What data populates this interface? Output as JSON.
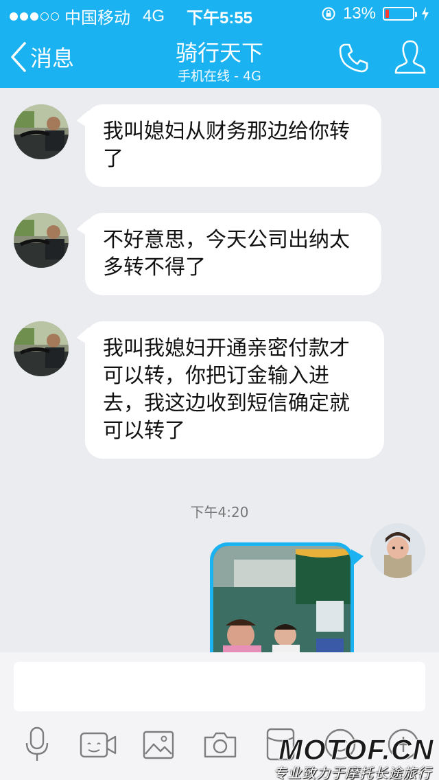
{
  "status_bar": {
    "carrier": "中国移动",
    "network": "4G",
    "time": "下午5:55",
    "battery_percent": "13%",
    "battery_level": 0.13,
    "signal_bars": 3
  },
  "nav": {
    "back_label": "消息",
    "title": "骑行天下",
    "subtitle": "手机在线 - 4G",
    "icons": [
      "back-chevron-icon",
      "phone-icon",
      "person-icon"
    ]
  },
  "messages": [
    {
      "sender": "contact",
      "text": "我叫媳妇从财务那边给你转了"
    },
    {
      "sender": "contact",
      "text": "不好意思，今天公司出纳太多转不得了"
    },
    {
      "sender": "contact",
      "text": "我叫我媳妇开通亲密付款才可以转，你把订金输入进去，我这边收到短信确定就可以转了"
    }
  ],
  "timestamp": "下午4:20",
  "my_message": {
    "type": "image"
  },
  "input": {
    "placeholder": ""
  },
  "toolbar": {
    "icons": [
      "microphone-icon",
      "video-icon",
      "image-icon",
      "camera-icon",
      "red-packet-icon",
      "emoji-icon",
      "plus-icon"
    ]
  },
  "watermark": {
    "logo": "MOTOF.CN",
    "slogan": "专业致力于摩托长途旅行"
  },
  "colors": {
    "accent": "#1ab2f0",
    "background": "#ebecf0"
  }
}
